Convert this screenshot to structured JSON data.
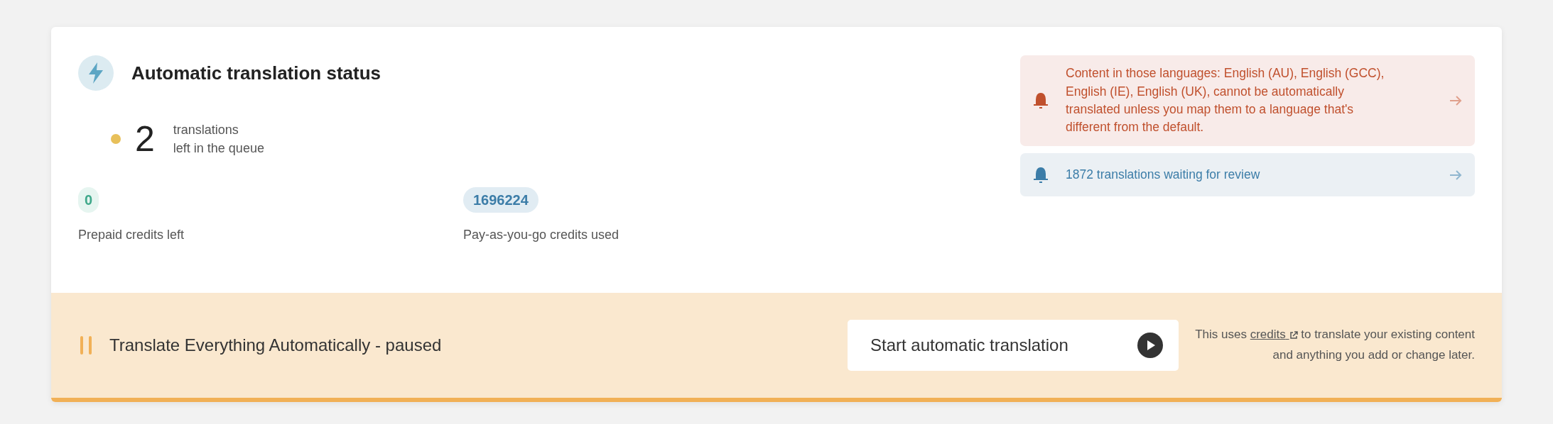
{
  "status_card": {
    "title": "Automatic translation status",
    "queue": {
      "count": "2",
      "label_line_1": "translations",
      "label_line_2": "left in the queue",
      "color": "#e8c05a"
    },
    "credits": [
      {
        "kind": "prepaid",
        "value": "0",
        "label": "Prepaid credits left"
      },
      {
        "kind": "payg",
        "value": "1696224",
        "label": "Pay-as-you-go credits used"
      }
    ],
    "notices": [
      {
        "kind": "error",
        "text": "Content in those languages: English (AU), English (GCC), English (IE), English (UK), cannot be automatically translated unless you map them to a language that's different from the default."
      },
      {
        "kind": "info",
        "text": "1872 translations waiting for review"
      }
    ]
  },
  "footer": {
    "status": "Translate Everything Automatically - paused",
    "paused": true,
    "button": "Start automatic translation",
    "help_before": "This uses",
    "help_link": "credits",
    "help_after": "to translate your existing content and anything you add or change later."
  }
}
